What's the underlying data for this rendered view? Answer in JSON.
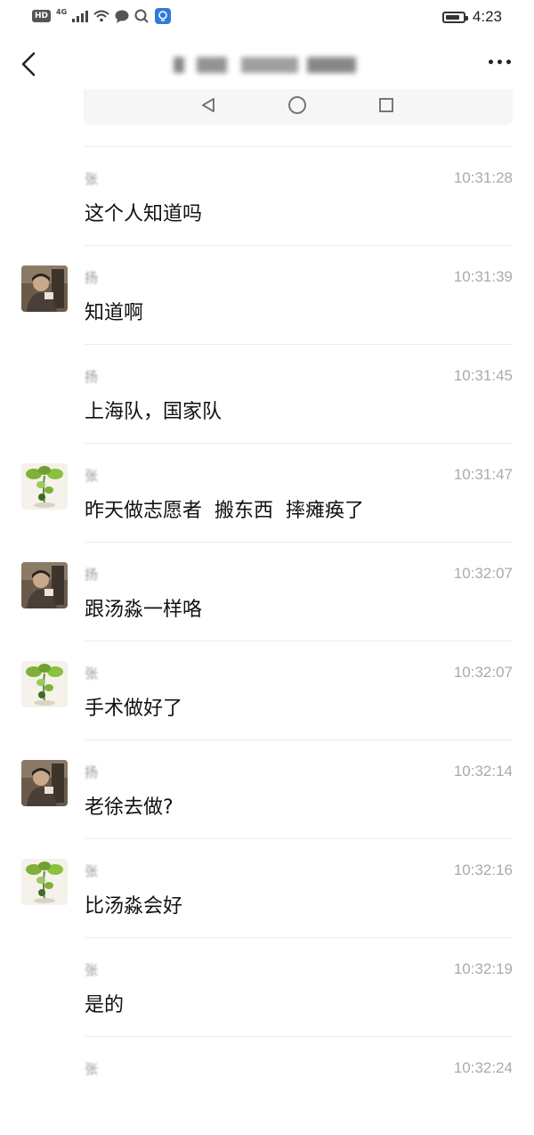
{
  "status_bar": {
    "hd": "HD",
    "network": "4G",
    "time": "4:23",
    "battery_level": 0.85
  },
  "nav": {
    "title": "",
    "back_icon": "chevron-left-icon",
    "more_icon": "more-horizontal-icon"
  },
  "messages": [
    {
      "sender": "张",
      "time": "10:31:28",
      "text": "这个人知道吗",
      "avatar": ""
    },
    {
      "sender": "扬",
      "time": "10:31:39",
      "text": "知道啊",
      "avatar": "person-photo"
    },
    {
      "sender": "扬",
      "time": "10:31:45",
      "text": "上海队，国家队",
      "avatar": ""
    },
    {
      "sender": "张",
      "time": "10:31:47",
      "text": "昨天做志愿者  搬东西  摔瘫痪了",
      "avatar": "plant-image"
    },
    {
      "sender": "扬",
      "time": "10:32:07",
      "text": "跟汤淼一样咯",
      "avatar": "person-photo"
    },
    {
      "sender": "张",
      "time": "10:32:07",
      "text": "手术做好了",
      "avatar": "plant-image"
    },
    {
      "sender": "扬",
      "time": "10:32:14",
      "text": "老徐去做?",
      "avatar": "person-photo"
    },
    {
      "sender": "张",
      "time": "10:32:16",
      "text": "比汤淼会好",
      "avatar": "plant-image"
    },
    {
      "sender": "张",
      "time": "10:32:19",
      "text": "是的",
      "avatar": ""
    },
    {
      "sender": "张",
      "time": "10:32:24",
      "text": "",
      "avatar": ""
    }
  ]
}
